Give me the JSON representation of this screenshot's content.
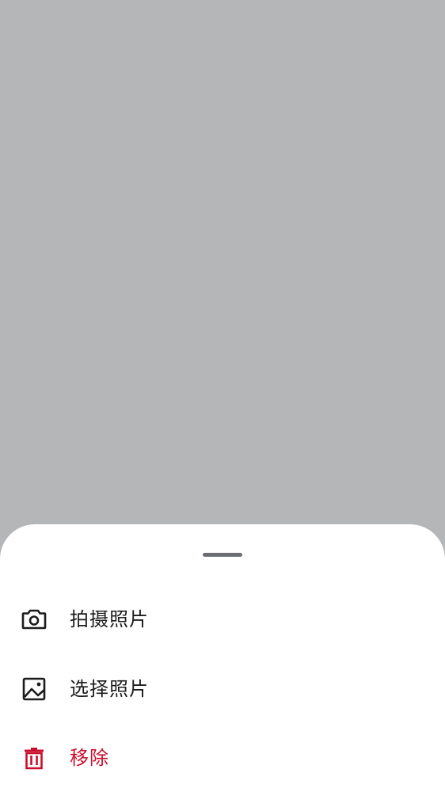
{
  "sheet": {
    "items": [
      {
        "label": "拍摄照片",
        "icon": "camera-icon"
      },
      {
        "label": "选择照片",
        "icon": "image-icon"
      },
      {
        "label": "移除",
        "icon": "trash-icon"
      }
    ]
  },
  "colors": {
    "backdrop": "#b5b6b8",
    "sheet": "#ffffff",
    "handle": "#6b6f75",
    "text": "#1c1c1e",
    "danger": "#c8102e"
  }
}
